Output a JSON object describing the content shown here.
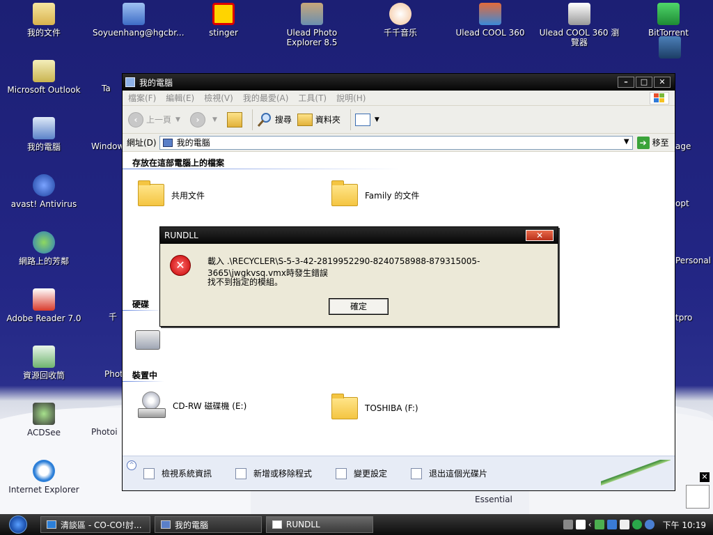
{
  "desktop": {
    "icons": [
      {
        "label": "我的文件",
        "icon": "my-documents-icon"
      },
      {
        "label": "Soyuenhang@hgcbr...",
        "icon": "network-user-icon"
      },
      {
        "label": "stinger",
        "icon": "stinger-icon"
      },
      {
        "label": "Ulead Photo Explorer 8.5",
        "icon": "photo-explorer-icon"
      },
      {
        "label": "千千音乐",
        "icon": "music-player-icon"
      },
      {
        "label": "Ulead COOL 360",
        "icon": "cool360-icon"
      },
      {
        "label": "Ulead COOL 360 瀏覽器",
        "icon": "cool360-viewer-icon"
      },
      {
        "label": "BitTorrent",
        "icon": "bittorrent-icon"
      },
      {
        "label": "Microsoft Outlook",
        "icon": "outlook-icon"
      },
      {
        "label": "我的電腦",
        "icon": "my-computer-icon"
      },
      {
        "label": "avast! Antivirus",
        "icon": "avast-icon"
      },
      {
        "label": "網路上的芳鄰",
        "icon": "network-places-icon"
      },
      {
        "label": "Adobe Reader 7.0",
        "icon": "adobe-reader-icon"
      },
      {
        "label": "資源回收筒",
        "icon": "recycle-bin-icon"
      },
      {
        "label": "ACDSee",
        "icon": "acdsee-icon"
      },
      {
        "label": "Internet Explorer",
        "icon": "ie-icon"
      }
    ],
    "partial_labels": [
      "Ta",
      "Window",
      "Phot",
      "Photoi",
      "千",
      "age",
      "opt",
      "Personal",
      "tpro",
      "Essential"
    ]
  },
  "explorer": {
    "title": "我的電腦",
    "menu": [
      "檔案(F)",
      "編輯(E)",
      "檢視(V)",
      "我的最愛(A)",
      "工具(T)",
      "說明(H)"
    ],
    "toolbar": {
      "back": "上一頁",
      "search": "搜尋",
      "folders": "資料夾"
    },
    "address_label": "網址(D)",
    "address_value": "我的電腦",
    "go_label": "移至",
    "section_files": "存放在這部電腦上的檔案",
    "section_hdd_partial": "硬碟",
    "section_devices_partial": "裝置中",
    "items": {
      "shared_docs": "共用文件",
      "family_docs": "Family 的文件",
      "cdrw": "CD-RW 磁碟機 (E:)",
      "toshiba": "TOSHIBA (F:)"
    },
    "tasks": [
      "檢視系統資訊",
      "新增或移除程式",
      "變更設定",
      "退出這個光碟片"
    ]
  },
  "dialog": {
    "title": "RUNDLL",
    "message1": "載入 .\\RECYCLER\\S-5-3-42-2819952290-8240758988-879315005-3665\\jwgkvsq.vmx時發生錯誤",
    "message2": "找不到指定的模組。",
    "ok": "確定"
  },
  "taskbar": {
    "tasks": [
      "清談區 - CO-CO!討...",
      "我的電腦",
      "RUNDLL"
    ],
    "clock": "下午 10:19"
  }
}
